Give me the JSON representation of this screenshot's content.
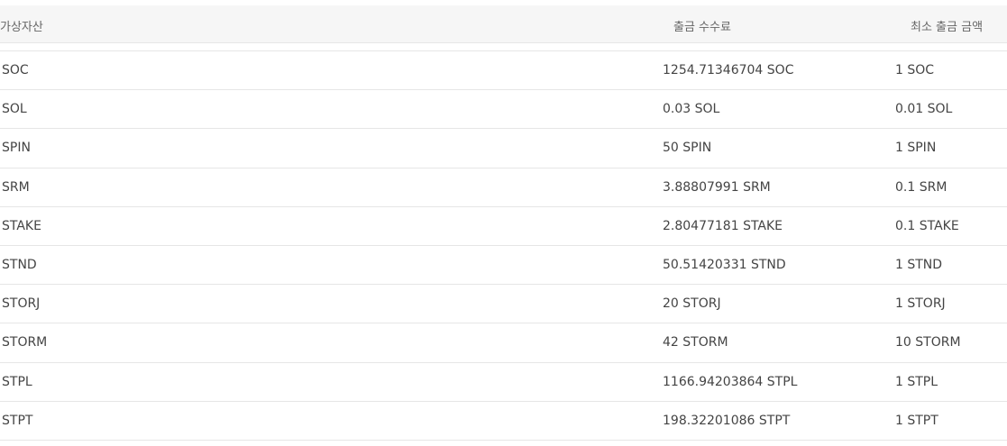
{
  "table": {
    "headers": {
      "asset": "가상자산",
      "fee": "출금 수수료",
      "min_amount": "최소 출금 금액"
    },
    "rows": [
      {
        "asset": "SOC",
        "fee": "1254.71346704 SOC",
        "min_amount": "1 SOC"
      },
      {
        "asset": "SOL",
        "fee": "0.03 SOL",
        "min_amount": "0.01 SOL"
      },
      {
        "asset": "SPIN",
        "fee": "50 SPIN",
        "min_amount": "1 SPIN"
      },
      {
        "asset": "SRM",
        "fee": "3.88807991 SRM",
        "min_amount": "0.1 SRM"
      },
      {
        "asset": "STAKE",
        "fee": "2.80477181 STAKE",
        "min_amount": "0.1 STAKE"
      },
      {
        "asset": "STND",
        "fee": "50.51420331 STND",
        "min_amount": "1 STND"
      },
      {
        "asset": "STORJ",
        "fee": "20 STORJ",
        "min_amount": "1 STORJ"
      },
      {
        "asset": "STORM",
        "fee": "42 STORM",
        "min_amount": "10 STORM"
      },
      {
        "asset": "STPL",
        "fee": "1166.94203864 STPL",
        "min_amount": "1 STPL"
      },
      {
        "asset": "STPT",
        "fee": "198.32201086 STPT",
        "min_amount": "1 STPT"
      }
    ]
  }
}
